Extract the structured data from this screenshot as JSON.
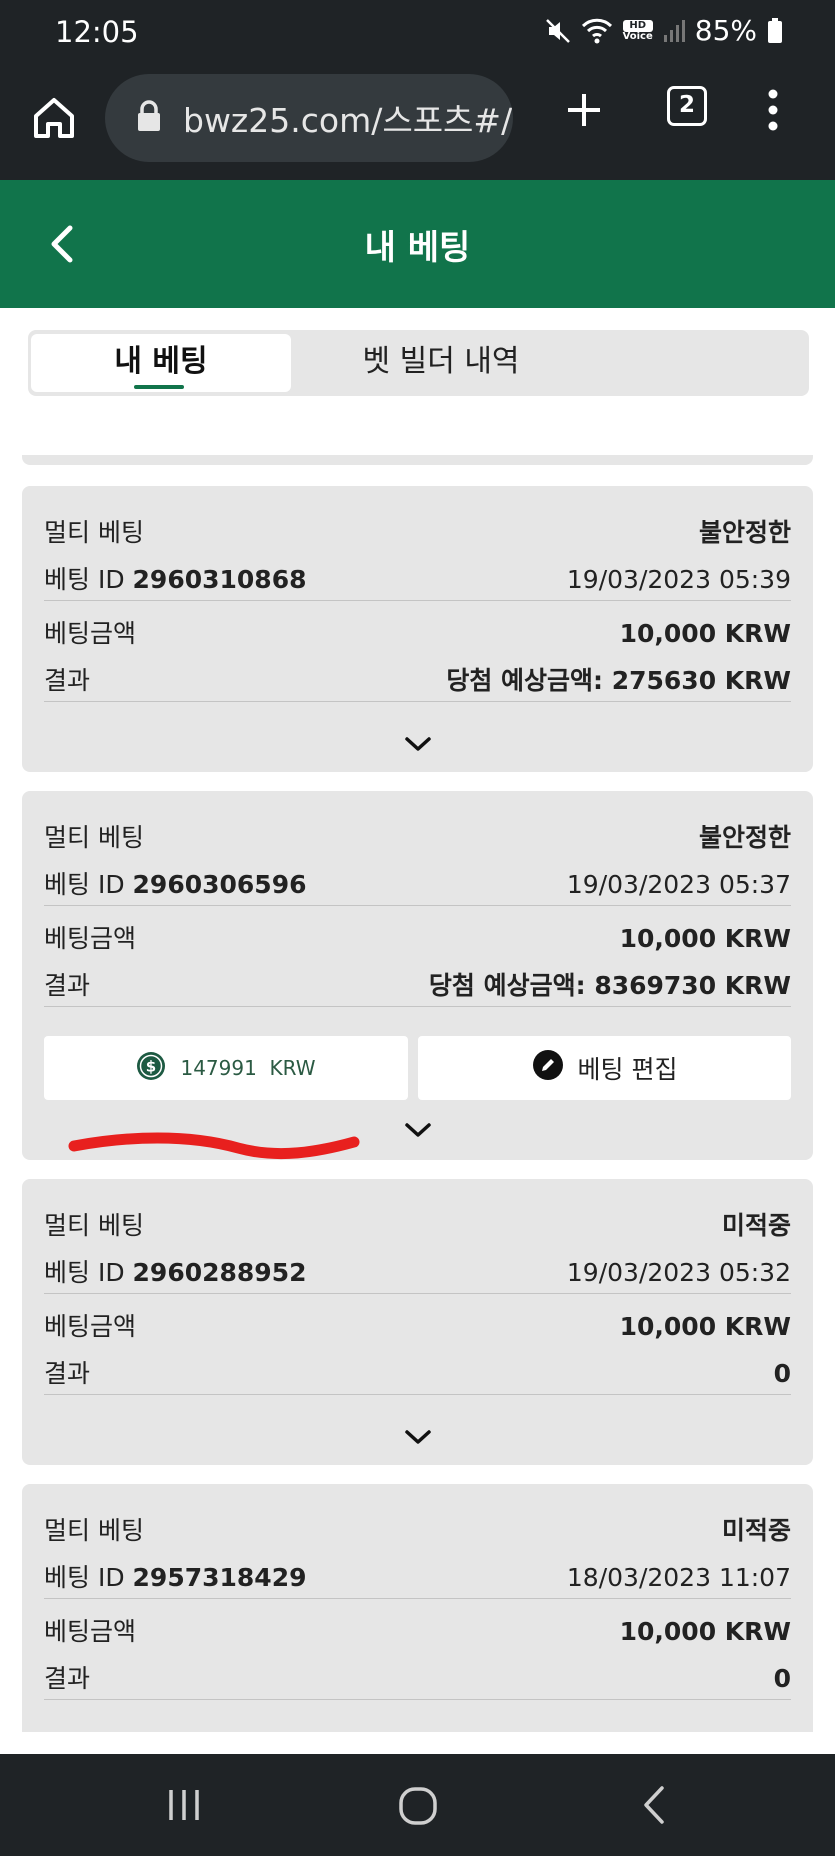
{
  "status_bar": {
    "time": "12:05",
    "hd_label": "HD",
    "voice_label": "Voice",
    "battery": "85%",
    "icons": [
      "mute-icon",
      "wifi-icon",
      "hd-voice-icon",
      "signal-icon",
      "battery-icon"
    ]
  },
  "browser": {
    "url": "bwz25.com/스포츠#/",
    "tab_count": "2",
    "icons": [
      "home-icon",
      "lock-icon",
      "plus-icon",
      "menu-dots-icon"
    ]
  },
  "header": {
    "title": "내 베팅",
    "back_icon": "chevron-left-icon"
  },
  "tabs": [
    {
      "label": "내 베팅",
      "active": true
    },
    {
      "label": "벳 빌더 내역",
      "active": false
    }
  ],
  "labels": {
    "bet_amount": "베팅금액",
    "result": "결과",
    "bet_id_prefix": "베팅 ID"
  },
  "bets": [
    {
      "type": "멀티 베팅",
      "status": "불안정한",
      "id": "2960310868",
      "datetime": "19/03/2023 05:39",
      "amount": "10,000 KRW",
      "result": "당첨 예상금액: 275630 KRW"
    },
    {
      "type": "멀티 베팅",
      "status": "불안정한",
      "id": "2960306596",
      "datetime": "19/03/2023 05:37",
      "amount": "10,000 KRW",
      "result": "당첨 예상금액: 8369730 KRW",
      "cashout_label": "147991  KRW",
      "edit_label": "베팅 편집"
    },
    {
      "type": "멀티 베팅",
      "status": "미적중",
      "id": "2960288952",
      "datetime": "19/03/2023 05:32",
      "amount": "10,000 KRW",
      "result": "0"
    },
    {
      "type": "멀티 베팅",
      "status": "미적중",
      "id": "2957318429",
      "datetime": "18/03/2023 11:07",
      "amount": "10,000 KRW",
      "result": "0"
    }
  ],
  "colors": {
    "brand_green": "#11744b",
    "status_pending": "#d9503b",
    "card_bg": "#e6e6e6",
    "system_bar": "#1f2326",
    "annotation_red": "#e8201e"
  },
  "nav": {
    "icons": [
      "recents-icon",
      "home-circle-icon",
      "back-icon"
    ]
  }
}
